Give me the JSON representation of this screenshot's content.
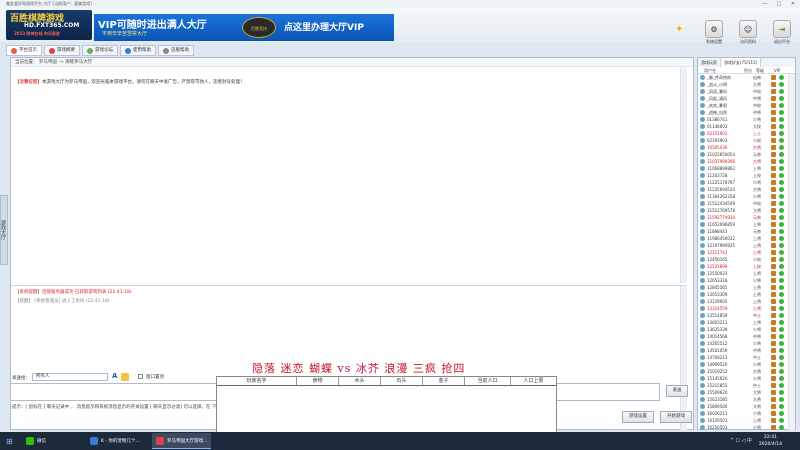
{
  "window": {
    "title": "美女爱好网游戏平台 大厅 [当前用户：爱美游戏]",
    "minimize": "—",
    "maximize": "□",
    "close": "✕"
  },
  "banner": {
    "logo_line1": "百胜棋牌游戏",
    "logo_line2": "HD.FXT365.COM",
    "logo_line3": "2013 财神在线 你可奇迹",
    "ad_text1": "VIP可随时进出满人大厅",
    "ad_text2": "不用辛辛苦苦拼大厅",
    "ad_center": "百胜竞技",
    "ad_text3": "点这里办理大厅VIP"
  },
  "toolbar": [
    {
      "label": "系统设置",
      "icon": "gear-icon",
      "glyph": "⚙"
    },
    {
      "label": "访问资料",
      "icon": "user-icon",
      "glyph": "☺"
    },
    {
      "label": "退出平台",
      "icon": "exit-icon",
      "glyph": "⇥"
    }
  ],
  "tabs": [
    {
      "label": "平台首页",
      "color": "#e8584a"
    },
    {
      "label": "游戏摘要",
      "color": "#d44"
    },
    {
      "label": "游戏论坛",
      "color": "#6a6"
    },
    {
      "label": "使用帮助",
      "color": "#3a7bd5"
    },
    {
      "label": "首服帮助",
      "color": "#888"
    }
  ],
  "breadcrumb": "当前位置：  罗马帝国  ->  演练罗马大厅",
  "notice": {
    "label": "【温馨提醒】",
    "text": "本游戏大厅为罗马帝国，欢迎光临本游戏平台，请勿在聊天中发广告，严禁辱骂他人，违者封号处理！"
  },
  "side_handle": "游戏大厅",
  "system_lines": [
    {
      "text": "【系统提醒】连接服务器成功 已获取游戏列表 (22:41:18)",
      "style": "red"
    },
    {
      "text": "【提醒】 [系统管理员] 进入了房间 (22:41:18)",
      "style": "gray"
    }
  ],
  "team_line": "隐落 迷恋 蝴蝶 vs 冰芥 浪漫 三疯 抢四",
  "send": {
    "label": "发送给：",
    "target": "所有人",
    "font_button": "A",
    "checkbox_label": "窗口置顶",
    "send_button": "发送"
  },
  "tips": "提示：[ 鼠标在 ] 聊天记录中    ，   消息提示和系统消息显示的开关设置 [ 聊天显示过滤] 可以选择，在 下面",
  "bottom_buttons": [
    {
      "label": "游戏设置"
    },
    {
      "label": "开始游戏"
    }
  ],
  "overlay": {
    "columns": [
      "玩家名字",
      "食物",
      "木头",
      "石头",
      "金子",
      "当前人口",
      "人口上限"
    ]
  },
  "user_panel": {
    "tabs": [
      "游戏玩家",
      "游戏好友(75/115)"
    ],
    "columns": [
      "用户名",
      "积分",
      "等级",
      "VIP"
    ],
    "users": [
      {
        "name": "_聊_传奇侠的",
        "level": "仙帝",
        "red": false
      },
      {
        "name": "_战斗_小明",
        "level": "大将",
        "red": false
      },
      {
        "name": "_风语_暴风",
        "level": "中校",
        "red": false
      },
      {
        "name": "_风起_清风",
        "level": "中将",
        "red": false
      },
      {
        "name": "_欢欢_暴君",
        "level": "中校",
        "red": false
      },
      {
        "name": "_战神_自然",
        "level": "中将",
        "red": false
      },
      {
        "name": "01386741",
        "level": "少将",
        "red": false
      },
      {
        "name": "01146003",
        "level": "大校",
        "red": false
      },
      {
        "name": "02151902",
        "level": "上士",
        "red": true
      },
      {
        "name": "02193903",
        "level": "少校",
        "red": false
      },
      {
        "name": "10565436",
        "level": "大将",
        "red": true
      },
      {
        "name": "11022650054",
        "level": "元帅",
        "red": false
      },
      {
        "name": "11037999396",
        "level": "大将",
        "red": true
      },
      {
        "name": "11068899862",
        "level": "上将",
        "red": false
      },
      {
        "name": "11203728",
        "level": "上校",
        "red": false
      },
      {
        "name": "11225178797",
        "level": "少将",
        "red": false
      },
      {
        "name": "11235694524",
        "level": "大将",
        "red": false
      },
      {
        "name": "11304262258",
        "level": "少将",
        "red": false
      },
      {
        "name": "11512434549",
        "level": "中校",
        "red": false
      },
      {
        "name": "11512769578",
        "level": "大将",
        "red": false
      },
      {
        "name": "11592774930",
        "level": "元帅",
        "red": true
      },
      {
        "name": "11652096859",
        "level": "上将",
        "red": false
      },
      {
        "name": "11898443",
        "level": "元帅",
        "red": false
      },
      {
        "name": "11986456032",
        "level": "上将",
        "red": false
      },
      {
        "name": "12197990935",
        "level": "上将",
        "red": false
      },
      {
        "name": "12211743",
        "level": "上将",
        "red": true
      },
      {
        "name": "12456165",
        "level": "少校",
        "red": false
      },
      {
        "name": "12533899",
        "level": "上校",
        "red": true
      },
      {
        "name": "12550023",
        "level": "上将",
        "red": false
      },
      {
        "name": "12653318",
        "level": "少将",
        "red": false
      },
      {
        "name": "12845565",
        "level": "上将",
        "red": false
      },
      {
        "name": "13053309",
        "level": "上将",
        "red": false
      },
      {
        "name": "13129005",
        "level": "上将",
        "red": false
      },
      {
        "name": "13314559",
        "level": "上将",
        "red": true
      },
      {
        "name": "13514859",
        "level": "中士",
        "red": false
      },
      {
        "name": "13603211",
        "level": "上将",
        "red": false
      },
      {
        "name": "13635339",
        "level": "少将",
        "red": false
      },
      {
        "name": "14014568",
        "level": "中将",
        "red": false
      },
      {
        "name": "14265512",
        "level": "少将",
        "red": false
      },
      {
        "name": "14501059",
        "level": "中将",
        "red": false
      },
      {
        "name": "14709213",
        "level": "中士",
        "red": false
      },
      {
        "name": "14909520",
        "level": "少将",
        "red": false
      },
      {
        "name": "15019252",
        "level": "大将",
        "red": false
      },
      {
        "name": "15145620",
        "level": "少将",
        "red": false
      },
      {
        "name": "15215855",
        "level": "中士",
        "red": false
      },
      {
        "name": "15509620",
        "level": "大将",
        "red": false
      },
      {
        "name": "15623185",
        "level": "大将",
        "red": false
      },
      {
        "name": "15809560",
        "level": "大将",
        "red": false
      },
      {
        "name": "16026211",
        "level": "少将",
        "red": false
      },
      {
        "name": "16129501",
        "level": "上将",
        "red": false
      },
      {
        "name": "16250503",
        "level": "少将",
        "red": false
      },
      {
        "name": "16305819",
        "level": "少将",
        "red": false
      },
      {
        "name": "16518950",
        "level": "少将",
        "red": false
      },
      {
        "name": "16890212",
        "level": "少将",
        "red": false
      }
    ]
  },
  "taskbar": {
    "items": [
      {
        "label": "微信",
        "color": "#2dc100"
      },
      {
        "label": "K - 你的宠物几个...",
        "color": "#3a7bd5"
      },
      {
        "label": "罗马帝国大厅游戏...",
        "color": "#d44"
      }
    ],
    "tray": "^  ☐  ◁  中",
    "time": "22:41",
    "date": "2020/4/14"
  }
}
